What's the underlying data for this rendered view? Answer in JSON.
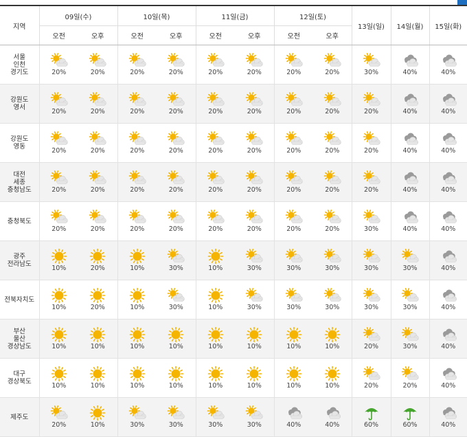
{
  "header": {
    "region_label": "지역",
    "days_split": [
      {
        "label": "09일(수)",
        "halves": [
          "오전",
          "오후"
        ]
      },
      {
        "label": "10일(목)",
        "halves": [
          "오전",
          "오후"
        ]
      },
      {
        "label": "11일(금)",
        "halves": [
          "오전",
          "오후"
        ]
      },
      {
        "label": "12일(토)",
        "halves": [
          "오전",
          "오후"
        ]
      }
    ],
    "days_whole": [
      "13일(일)",
      "14일(월)",
      "15일(화)"
    ]
  },
  "colors": {
    "sun": "#f5b400",
    "cloud_light": "#e6e6e6",
    "cloud_dark": "#9a9a9a",
    "umbrella": "#45a52d",
    "header_rule": "#333333",
    "tab_accent": "#1e6fc0"
  },
  "rows": [
    {
      "region": [
        "서울",
        "인천",
        "경기도"
      ],
      "cells": [
        [
          "partly-sunny-icon",
          "20%"
        ],
        [
          "partly-sunny-icon",
          "20%"
        ],
        [
          "partly-sunny-icon",
          "20%"
        ],
        [
          "partly-sunny-icon",
          "20%"
        ],
        [
          "partly-sunny-icon",
          "20%"
        ],
        [
          "partly-sunny-icon",
          "20%"
        ],
        [
          "partly-sunny-icon",
          "20%"
        ],
        [
          "partly-sunny-icon",
          "20%"
        ],
        [
          "partly-sunny-icon",
          "30%"
        ],
        [
          "cloudy-icon",
          "40%"
        ],
        [
          "cloudy-icon",
          "40%"
        ]
      ]
    },
    {
      "region": [
        "강원도",
        "영서"
      ],
      "cells": [
        [
          "partly-sunny-icon",
          "20%"
        ],
        [
          "partly-sunny-icon",
          "20%"
        ],
        [
          "partly-sunny-icon",
          "20%"
        ],
        [
          "partly-sunny-icon",
          "20%"
        ],
        [
          "partly-sunny-icon",
          "20%"
        ],
        [
          "partly-sunny-icon",
          "20%"
        ],
        [
          "partly-sunny-icon",
          "20%"
        ],
        [
          "partly-sunny-icon",
          "20%"
        ],
        [
          "partly-sunny-icon",
          "20%"
        ],
        [
          "cloudy-icon",
          "40%"
        ],
        [
          "cloudy-icon",
          "40%"
        ]
      ]
    },
    {
      "region": [
        "강원도",
        "영동"
      ],
      "cells": [
        [
          "partly-sunny-icon",
          "20%"
        ],
        [
          "partly-sunny-icon",
          "20%"
        ],
        [
          "partly-sunny-icon",
          "20%"
        ],
        [
          "partly-sunny-icon",
          "20%"
        ],
        [
          "partly-sunny-icon",
          "20%"
        ],
        [
          "partly-sunny-icon",
          "20%"
        ],
        [
          "partly-sunny-icon",
          "20%"
        ],
        [
          "partly-sunny-icon",
          "20%"
        ],
        [
          "partly-sunny-icon",
          "20%"
        ],
        [
          "cloudy-icon",
          "40%"
        ],
        [
          "cloudy-icon",
          "40%"
        ]
      ]
    },
    {
      "region": [
        "대전",
        "세종",
        "충청남도"
      ],
      "cells": [
        [
          "partly-sunny-icon",
          "20%"
        ],
        [
          "partly-sunny-icon",
          "20%"
        ],
        [
          "partly-sunny-icon",
          "20%"
        ],
        [
          "partly-sunny-icon",
          "20%"
        ],
        [
          "partly-sunny-icon",
          "20%"
        ],
        [
          "partly-sunny-icon",
          "20%"
        ],
        [
          "partly-sunny-icon",
          "20%"
        ],
        [
          "partly-sunny-icon",
          "20%"
        ],
        [
          "partly-sunny-icon",
          "20%"
        ],
        [
          "cloudy-icon",
          "40%"
        ],
        [
          "cloudy-icon",
          "40%"
        ]
      ]
    },
    {
      "region": [
        "충청북도"
      ],
      "cells": [
        [
          "partly-sunny-icon",
          "20%"
        ],
        [
          "partly-sunny-icon",
          "20%"
        ],
        [
          "partly-sunny-icon",
          "20%"
        ],
        [
          "partly-sunny-icon",
          "20%"
        ],
        [
          "partly-sunny-icon",
          "20%"
        ],
        [
          "partly-sunny-icon",
          "20%"
        ],
        [
          "partly-sunny-icon",
          "20%"
        ],
        [
          "partly-sunny-icon",
          "20%"
        ],
        [
          "partly-sunny-icon",
          "30%"
        ],
        [
          "cloudy-icon",
          "40%"
        ],
        [
          "cloudy-icon",
          "40%"
        ]
      ]
    },
    {
      "region": [
        "광주",
        "전라남도"
      ],
      "cells": [
        [
          "sunny-icon",
          "10%"
        ],
        [
          "sunny-icon",
          "20%"
        ],
        [
          "sunny-icon",
          "10%"
        ],
        [
          "partly-sunny-icon",
          "30%"
        ],
        [
          "sunny-icon",
          "10%"
        ],
        [
          "partly-sunny-icon",
          "30%"
        ],
        [
          "partly-sunny-icon",
          "30%"
        ],
        [
          "partly-sunny-icon",
          "30%"
        ],
        [
          "partly-sunny-icon",
          "30%"
        ],
        [
          "partly-sunny-icon",
          "30%"
        ],
        [
          "cloudy-icon",
          "40%"
        ]
      ]
    },
    {
      "region": [
        "전북자치도"
      ],
      "cells": [
        [
          "sunny-icon",
          "10%"
        ],
        [
          "sunny-icon",
          "20%"
        ],
        [
          "sunny-icon",
          "10%"
        ],
        [
          "partly-sunny-icon",
          "30%"
        ],
        [
          "sunny-icon",
          "10%"
        ],
        [
          "partly-sunny-icon",
          "30%"
        ],
        [
          "partly-sunny-icon",
          "30%"
        ],
        [
          "partly-sunny-icon",
          "30%"
        ],
        [
          "partly-sunny-icon",
          "30%"
        ],
        [
          "partly-sunny-icon",
          "30%"
        ],
        [
          "cloudy-icon",
          "40%"
        ]
      ]
    },
    {
      "region": [
        "부산",
        "울산",
        "경상남도"
      ],
      "cells": [
        [
          "sunny-icon",
          "10%"
        ],
        [
          "sunny-icon",
          "10%"
        ],
        [
          "sunny-icon",
          "10%"
        ],
        [
          "sunny-icon",
          "10%"
        ],
        [
          "sunny-icon",
          "10%"
        ],
        [
          "sunny-icon",
          "10%"
        ],
        [
          "sunny-icon",
          "10%"
        ],
        [
          "sunny-icon",
          "10%"
        ],
        [
          "partly-sunny-icon",
          "20%"
        ],
        [
          "partly-sunny-icon",
          "30%"
        ],
        [
          "cloudy-icon",
          "40%"
        ]
      ]
    },
    {
      "region": [
        "대구",
        "경상북도"
      ],
      "cells": [
        [
          "sunny-icon",
          "10%"
        ],
        [
          "sunny-icon",
          "10%"
        ],
        [
          "sunny-icon",
          "10%"
        ],
        [
          "sunny-icon",
          "10%"
        ],
        [
          "sunny-icon",
          "10%"
        ],
        [
          "sunny-icon",
          "10%"
        ],
        [
          "sunny-icon",
          "10%"
        ],
        [
          "sunny-icon",
          "10%"
        ],
        [
          "partly-sunny-icon",
          "20%"
        ],
        [
          "partly-sunny-icon",
          "20%"
        ],
        [
          "cloudy-icon",
          "40%"
        ]
      ]
    },
    {
      "region": [
        "제주도"
      ],
      "cells": [
        [
          "partly-sunny-icon",
          "20%"
        ],
        [
          "sunny-icon",
          "10%"
        ],
        [
          "partly-sunny-icon",
          "30%"
        ],
        [
          "partly-sunny-icon",
          "30%"
        ],
        [
          "partly-sunny-icon",
          "30%"
        ],
        [
          "partly-sunny-icon",
          "30%"
        ],
        [
          "cloudy-icon",
          "40%"
        ],
        [
          "cloudy-icon",
          "40%"
        ],
        [
          "umbrella-icon",
          "60%"
        ],
        [
          "umbrella-icon",
          "60%"
        ],
        [
          "cloudy-icon",
          "40%"
        ]
      ]
    }
  ]
}
